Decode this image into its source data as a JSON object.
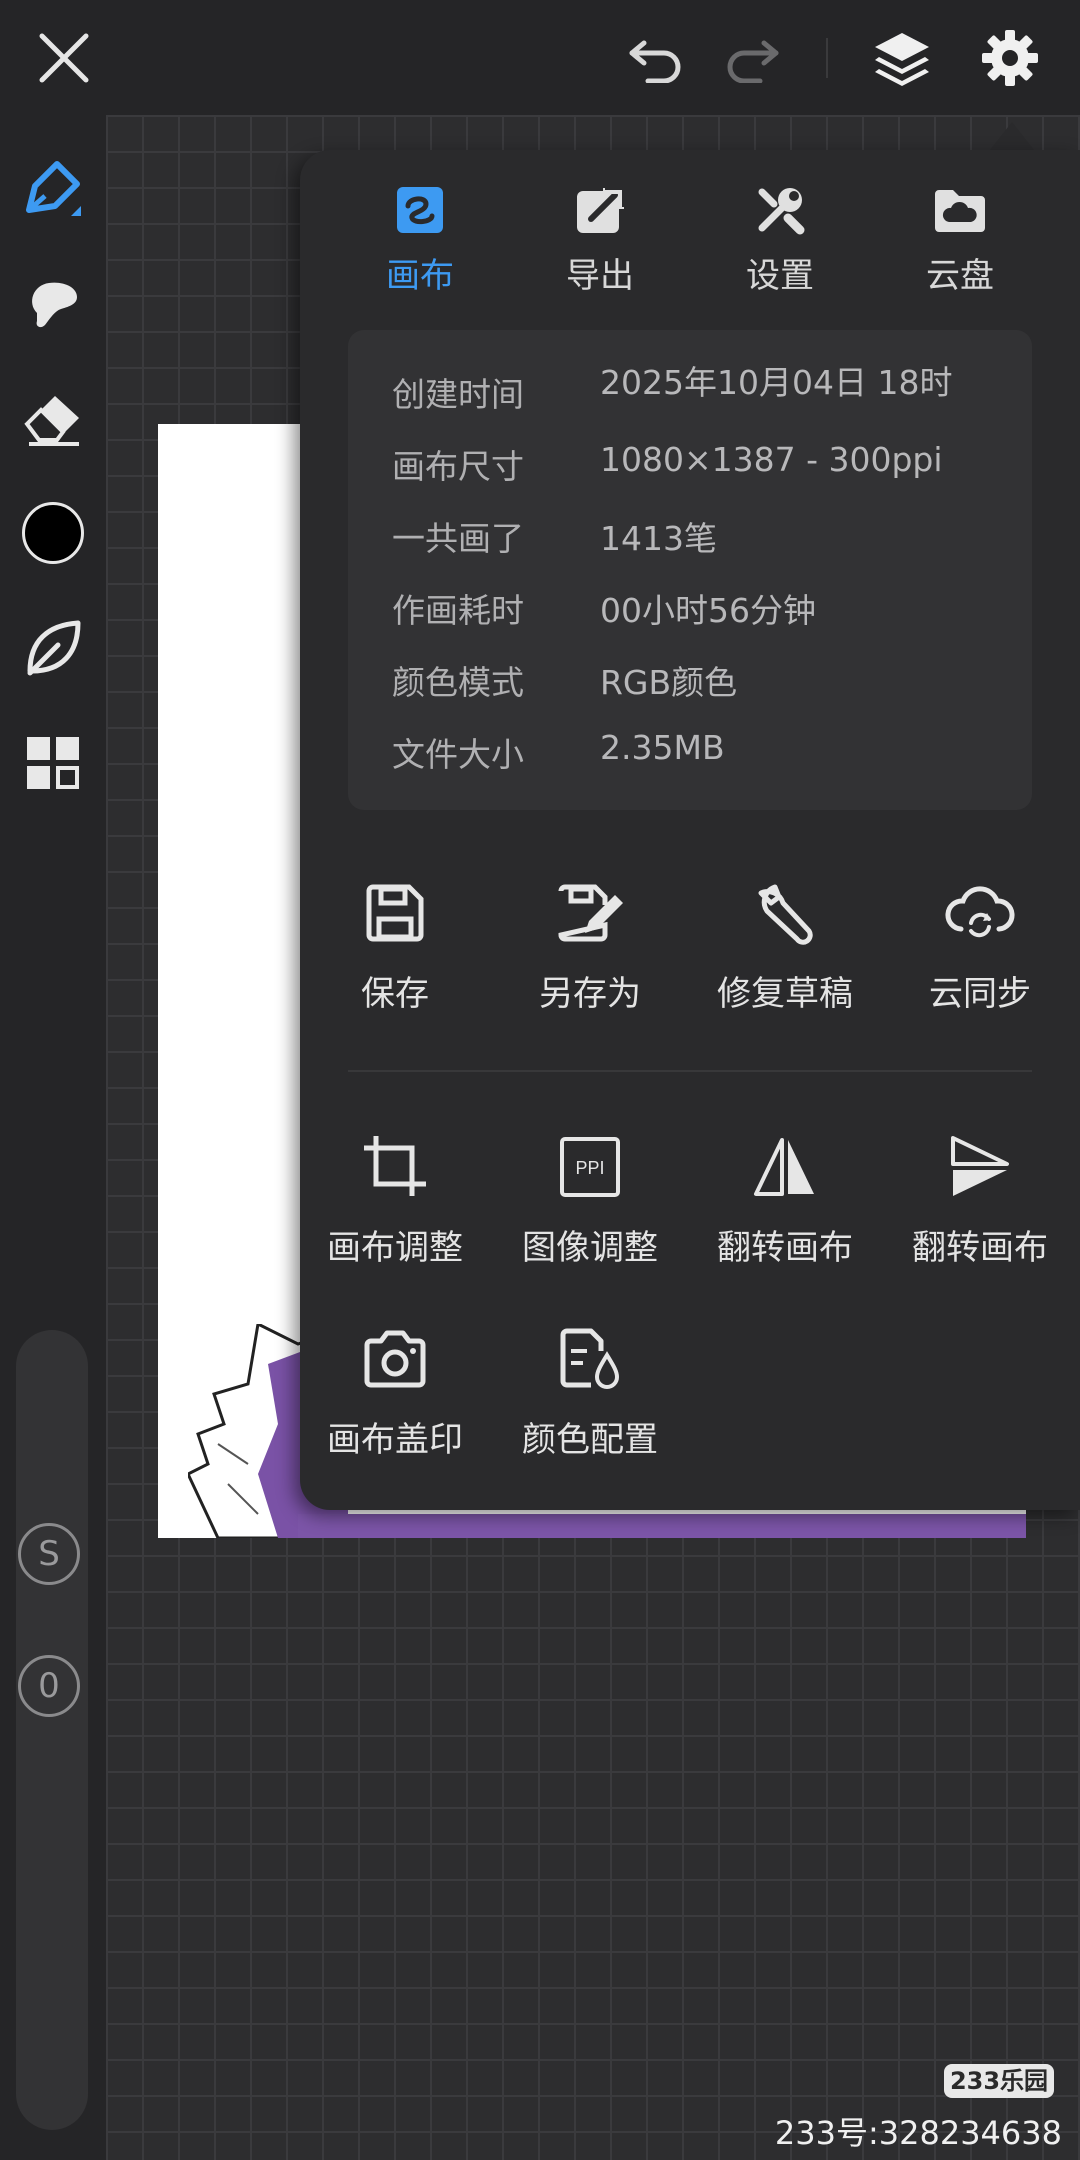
{
  "panel": {
    "tabs": [
      {
        "label": "画布",
        "icon": "canvas-icon",
        "active": true
      },
      {
        "label": "导出",
        "icon": "export-icon",
        "active": false
      },
      {
        "label": "设置",
        "icon": "settings-tools-icon",
        "active": false
      },
      {
        "label": "云盘",
        "icon": "cloud-drive-icon",
        "active": false
      }
    ],
    "info": [
      {
        "key": "创建时间",
        "value": "2025年10月04日 18时"
      },
      {
        "key": "画布尺寸",
        "value": "1080×1387 - 300ppi"
      },
      {
        "key": "一共画了",
        "value": "1413笔"
      },
      {
        "key": "作画耗时",
        "value": "00小时56分钟"
      },
      {
        "key": "颜色模式",
        "value": "RGB颜色"
      },
      {
        "key": "文件大小",
        "value": "2.35MB"
      }
    ],
    "actions_row1": [
      {
        "label": "保存",
        "icon": "save-icon"
      },
      {
        "label": "另存为",
        "icon": "save-as-icon"
      },
      {
        "label": "修复草稿",
        "icon": "wrench-icon"
      },
      {
        "label": "云同步",
        "icon": "cloud-sync-icon"
      }
    ],
    "actions_row2": [
      {
        "label": "画布调整",
        "icon": "crop-icon"
      },
      {
        "label": "图像调整",
        "icon": "ppi-icon"
      },
      {
        "label": "翻转画布",
        "icon": "flip-horizontal-icon"
      },
      {
        "label": "翻转画布",
        "icon": "flip-vertical-icon"
      }
    ],
    "actions_row3": [
      {
        "label": "画布盖印",
        "icon": "camera-icon"
      },
      {
        "label": "颜色配置",
        "icon": "color-profile-icon"
      }
    ],
    "ppi_icon_text": "PPI"
  },
  "rail": {
    "s_label": "S",
    "zero_label": "0",
    "current_color": "#000000",
    "accent": "#3d9af2"
  },
  "watermark": {
    "badge": "233乐园",
    "id_text": "233号:328234638"
  }
}
